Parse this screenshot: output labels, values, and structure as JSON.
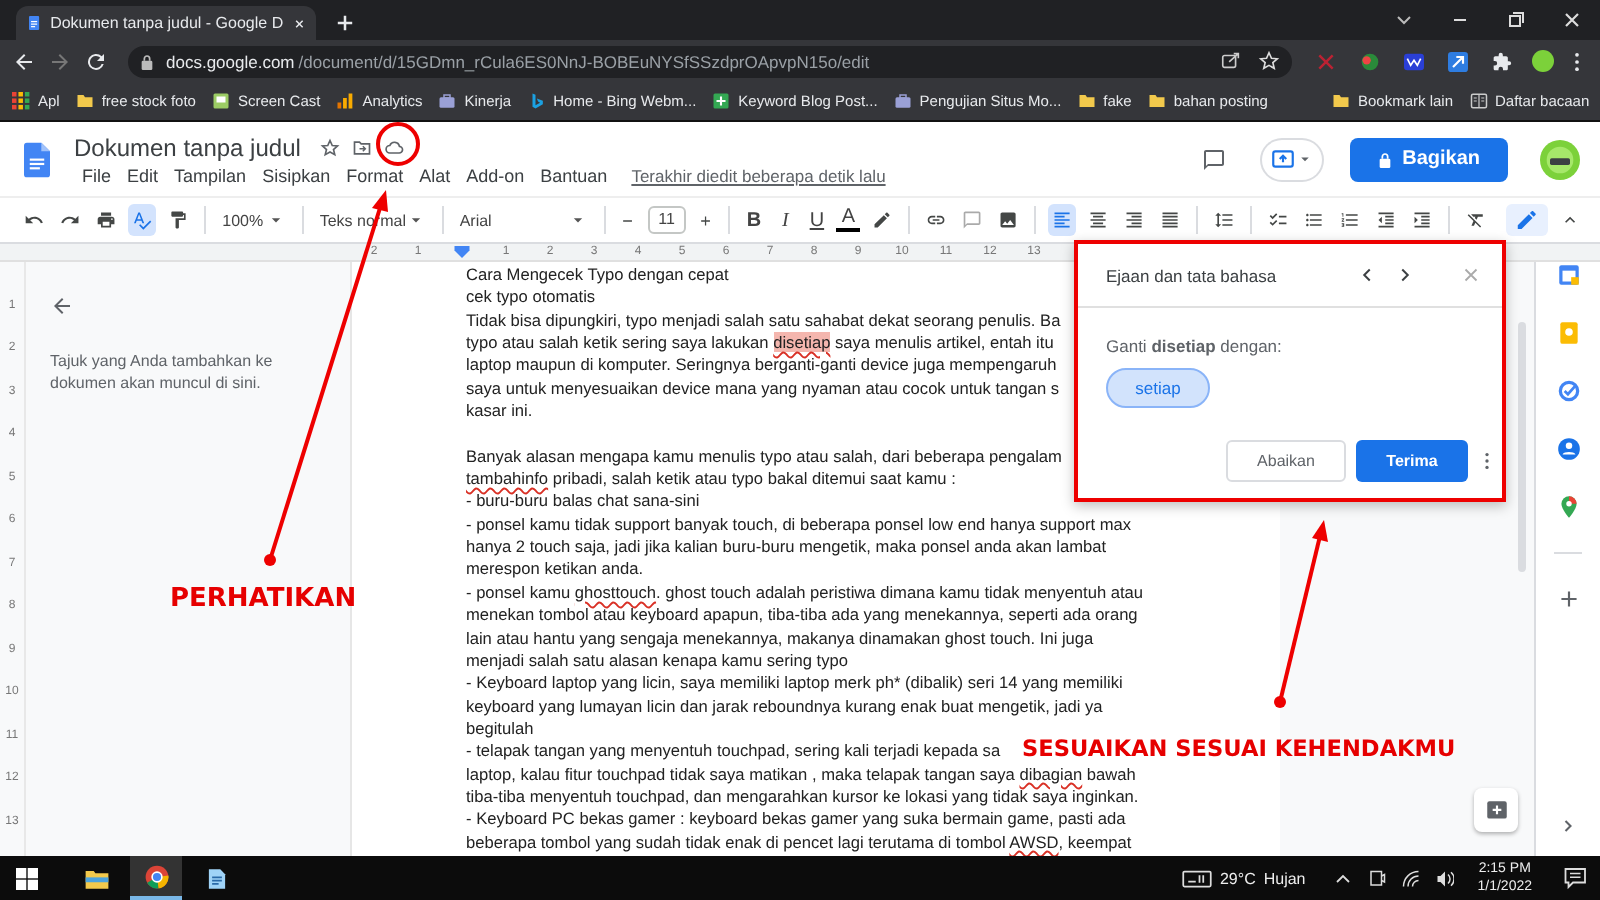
{
  "browser": {
    "tab_title": "Dokumen tanpa judul - Google D",
    "url_domain": "docs.google.com",
    "url_path": "/document/d/15GDmn_rCula6ES0NnJ-BOBEuNYSfSSzdprOApvpN15o/edit"
  },
  "bookmarks": [
    {
      "label": "Apl",
      "kind": "apps"
    },
    {
      "label": "free stock foto",
      "kind": "folder"
    },
    {
      "label": "Screen Cast",
      "kind": "page"
    },
    {
      "label": "Analytics",
      "kind": "chart"
    },
    {
      "label": "Kinerja",
      "kind": "briefcase"
    },
    {
      "label": "Home - Bing Webm...",
      "kind": "bing"
    },
    {
      "label": "Keyword Blog Post...",
      "kind": "sheet"
    },
    {
      "label": "Pengujian Situs Mo...",
      "kind": "briefcase"
    },
    {
      "label": "fake",
      "kind": "folder"
    },
    {
      "label": "bahan posting",
      "kind": "folder"
    }
  ],
  "other_bookmarks": [
    {
      "label": "Bookmark lain",
      "kind": "folder"
    },
    {
      "label": "Daftar bacaan",
      "kind": "reading"
    }
  ],
  "doc": {
    "title": "Dokumen tanpa judul",
    "menus": [
      "File",
      "Edit",
      "Tampilan",
      "Sisipkan",
      "Format",
      "Alat",
      "Add-on",
      "Bantuan"
    ],
    "last_edit": "Terakhir diedit beberapa detik lalu",
    "share": "Bagikan"
  },
  "toolbar": {
    "spellcheck_selected": true,
    "zoom": "100%",
    "style": "Teks normal",
    "font": "Arial",
    "size": "11",
    "format_letters": [
      "B",
      "I",
      "U",
      "A"
    ],
    "alignments": [
      {
        "kind": "left",
        "selected": true
      },
      {
        "kind": "center",
        "selected": false
      },
      {
        "kind": "right",
        "selected": false
      },
      {
        "kind": "justify",
        "selected": false
      }
    ]
  },
  "ruler": {
    "before_indent": [
      "2",
      "1"
    ],
    "after_indent": [
      "1",
      "2",
      "3",
      "4",
      "5",
      "6",
      "7",
      "8",
      "9",
      "10",
      "11",
      "12",
      "13"
    ],
    "vertical": [
      "1",
      "2",
      "3",
      "4",
      "5",
      "6",
      "7",
      "8",
      "9",
      "10",
      "11",
      "12",
      "13"
    ]
  },
  "outline": {
    "hint": "Tajuk yang Anda tambahkan ke dokumen akan muncul di sini."
  },
  "lines": [
    {
      "kind": "text",
      "parts": [
        {
          "text": "Cara Mengecek Typo dengan cepat",
          "kind": "plain"
        }
      ]
    },
    {
      "kind": "text",
      "parts": [
        {
          "text": "cek typo otomatis",
          "kind": "plain"
        }
      ]
    },
    {
      "kind": "text",
      "parts": [
        {
          "text": "Tidak bisa dipungkiri, typo menjadi salah satu sahabat dekat seorang penulis. Ba",
          "kind": "plain"
        }
      ]
    },
    {
      "kind": "text",
      "parts": [
        {
          "text": "typo atau salah ketik sering saya lakukan ",
          "kind": "plain"
        },
        {
          "text": "disetiap",
          "kind": "current-error"
        },
        {
          "text": " saya menulis artikel, entah itu",
          "kind": "plain"
        }
      ]
    },
    {
      "kind": "text",
      "parts": [
        {
          "text": "laptop maupun di komputer. Seringnya berganti-ganti device juga mempengaruh",
          "kind": "plain"
        }
      ]
    },
    {
      "kind": "text",
      "parts": [
        {
          "text": "saya untuk menyesuaikan device mana yang nyaman atau cocok untuk tangan s",
          "kind": "plain"
        }
      ]
    },
    {
      "kind": "text",
      "parts": [
        {
          "text": "kasar ini.",
          "kind": "plain"
        }
      ]
    },
    {
      "kind": "blank"
    },
    {
      "kind": "text",
      "parts": [
        {
          "text": "Banyak alasan mengapa kamu menulis typo atau salah, dari beberapa pengalam",
          "kind": "plain"
        }
      ]
    },
    {
      "kind": "text",
      "parts": [
        {
          "text": "tambahinfo",
          "kind": "error"
        },
        {
          "text": " pribadi, salah ketik atau typo bakal ditemui saat kamu :",
          "kind": "plain"
        }
      ]
    },
    {
      "kind": "text",
      "parts": [
        {
          "text": "- buru-buru balas chat sana-sini",
          "kind": "plain"
        }
      ]
    },
    {
      "kind": "text",
      "parts": [
        {
          "text": "- ponsel kamu tidak support banyak touch, di beberapa ponsel low end hanya support max",
          "kind": "plain"
        }
      ]
    },
    {
      "kind": "text",
      "parts": [
        {
          "text": "hanya 2 touch saja, jadi jika kalian buru-buru mengetik, maka ponsel anda akan lambat",
          "kind": "plain"
        }
      ]
    },
    {
      "kind": "text",
      "parts": [
        {
          "text": "merespon ketikan anda.",
          "kind": "plain"
        }
      ]
    },
    {
      "kind": "text",
      "parts": [
        {
          "text": "- ponsel kamu ",
          "kind": "plain"
        },
        {
          "text": "ghosttouch",
          "kind": "error"
        },
        {
          "text": ". ghost touch adalah peristiwa dimana kamu tidak menyentuh atau",
          "kind": "plain"
        }
      ]
    },
    {
      "kind": "text",
      "parts": [
        {
          "text": "menekan tombol atau keyboard apapun, tiba-tiba ada yang menekannya, seperti ada orang",
          "kind": "plain"
        }
      ]
    },
    {
      "kind": "text",
      "parts": [
        {
          "text": "lain atau hantu yang sengaja menekannya, makanya dinamakan ghost touch. Ini juga",
          "kind": "plain"
        }
      ]
    },
    {
      "kind": "text",
      "parts": [
        {
          "text": "menjadi salah satu alasan kenapa kamu sering typo",
          "kind": "plain"
        }
      ]
    },
    {
      "kind": "text",
      "parts": [
        {
          "text": "- Keyboard laptop yang licin, saya memiliki laptop merk ph* (dibalik) seri 14 yang memiliki",
          "kind": "plain"
        }
      ]
    },
    {
      "kind": "text",
      "parts": [
        {
          "text": "keyboard yang lumayan licin dan jarak reboundnya kurang enak buat mengetik, jadi ya",
          "kind": "plain"
        }
      ]
    },
    {
      "kind": "text",
      "parts": [
        {
          "text": "begitulah",
          "kind": "plain"
        }
      ]
    },
    {
      "kind": "text",
      "parts": [
        {
          "text": "- telapak tangan yang menyentuh touchpad, sering kali terjadi kepada sa",
          "kind": "plain"
        }
      ]
    },
    {
      "kind": "text",
      "parts": [
        {
          "text": "laptop, kalau fitur touchpad tidak saya matikan , maka telapak tangan saya ",
          "kind": "plain"
        },
        {
          "text": "dibagian",
          "kind": "error"
        },
        {
          "text": " bawah",
          "kind": "plain"
        }
      ]
    },
    {
      "kind": "text",
      "parts": [
        {
          "text": "tiba-tiba menyentuh touchpad, dan mengarahkan kursor ke lokasi yang tidak saya inginkan.",
          "kind": "plain"
        }
      ]
    },
    {
      "kind": "text",
      "parts": [
        {
          "text": "- Keyboard PC bekas gamer : keyboard bekas gamer yang suka bermain game, pasti ada",
          "kind": "plain"
        }
      ]
    },
    {
      "kind": "text",
      "parts": [
        {
          "text": "beberapa tombol yang sudah tidak enak di pencet lagi terutama di tombol ",
          "kind": "plain"
        },
        {
          "text": "AWSD",
          "kind": "error"
        },
        {
          "text": ", keempat",
          "kind": "plain"
        }
      ]
    }
  ],
  "spell_dialog": {
    "title": "Ejaan dan tata bahasa",
    "prompt": "Ganti **disetiap** dengan:",
    "suggestion": "setiap",
    "ignore": "Abaikan",
    "accept": "Terima"
  },
  "annotations": [
    {
      "text": "PERHATIKAN"
    },
    {
      "text": "SESUAIKAN SESUAI KEHENDAKMU"
    }
  ],
  "taskbar": {
    "apps": [
      {
        "kind": "explorer",
        "selected": false
      },
      {
        "kind": "chrome",
        "selected": true
      },
      {
        "kind": "notepad",
        "selected": false
      }
    ],
    "temperature": "29°C",
    "weather": "Hujan",
    "time": "2:15 PM",
    "date": "1/1/2022"
  }
}
